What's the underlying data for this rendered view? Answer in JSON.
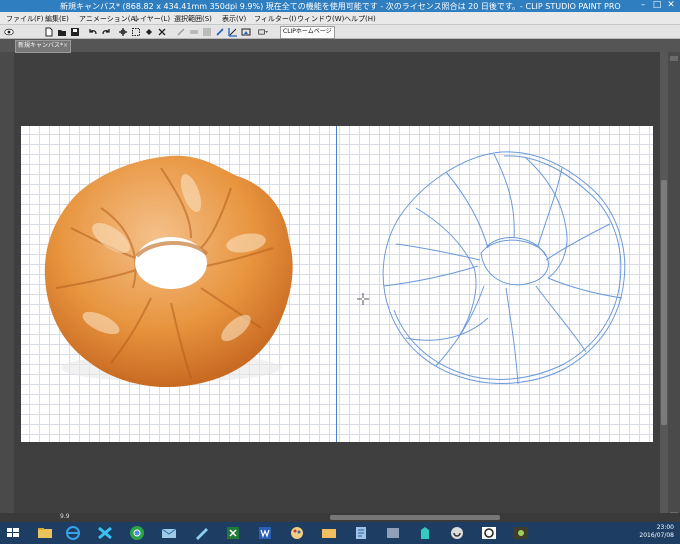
{
  "window": {
    "title": "新規キャンバス* (868.82 x 434.41mm 350dpi 9.9%)  現在全ての機能を使用可能です - 次のライセンス照合は 20 日後です。- CLIP STUDIO PAINT PRO",
    "minimize_icon": "minimize-icon",
    "maximize_icon": "maximize-icon",
    "close_icon": "close-icon"
  },
  "menu": [
    "ファイル(F)",
    "編集(E)",
    "アニメーション(A)",
    "レイヤー(L)",
    "選択範囲(S)",
    "表示(V)",
    "フィルター(I)",
    "ウィンドウ(W)",
    "ヘルプ(H)"
  ],
  "toolbar": {
    "homepage_label": "CLIPホームページ",
    "icons": [
      "clip-studio-icon",
      "new-icon",
      "open-icon",
      "save-icon",
      "undo-icon",
      "redo-icon",
      "transform-icon",
      "select-icon",
      "fill-icon",
      "delete-icon",
      "snap-icon",
      "ruler-icon",
      "perspective-icon",
      "pen-icon",
      "grid-icon",
      "view-icon"
    ]
  },
  "document_tab": {
    "label": "新規キャンバス*",
    "close": "×"
  },
  "status": {
    "zoom": "9.9"
  },
  "clock": {
    "time": "23:00",
    "date": "2016/07/08"
  },
  "taskbar": {
    "icons": [
      "start-icon",
      "explorer-icon",
      "ie-icon",
      "app-icon",
      "chrome-icon",
      "mail-icon",
      "note-icon",
      "excel-icon",
      "word-icon",
      "paint-icon",
      "folder-icon",
      "tool-icon",
      "clip-icon",
      "miku-icon",
      "app2-icon",
      "cat-icon",
      "game-icon"
    ]
  },
  "colors": {
    "titlebar": "#2f7ec0",
    "workspace": "#3f3f3f",
    "guide_line": "#4c7fd0",
    "sketch_stroke": "#5b8fd6",
    "donut": "#e8953f"
  }
}
